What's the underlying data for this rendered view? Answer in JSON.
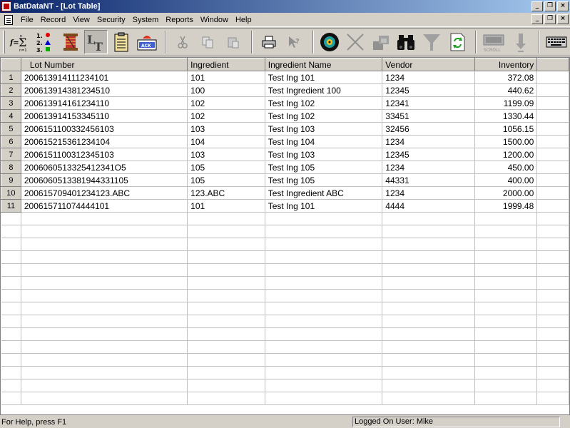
{
  "window": {
    "title": "BatDataNT - [Lot Table]",
    "min_glyph": "_",
    "restore_glyph": "❐",
    "close_glyph": "×"
  },
  "menu": {
    "items": [
      "File",
      "Record",
      "View",
      "Security",
      "System",
      "Reports",
      "Window",
      "Help"
    ]
  },
  "toolbar": {
    "buttons": [
      {
        "icon": "formula-sigma-icon"
      },
      {
        "icon": "numbered-shapes-icon"
      },
      {
        "icon": "thread-spool-icon"
      },
      {
        "icon": "lot-table-icon",
        "active": true
      },
      {
        "icon": "clipboard-icon"
      },
      {
        "icon": "ack-alarm-icon",
        "label": "ACK"
      },
      {
        "icon": "cut-icon"
      },
      {
        "icon": "copy-icon"
      },
      {
        "icon": "paste-icon"
      },
      {
        "icon": "print-icon"
      },
      {
        "icon": "context-help-icon"
      },
      {
        "icon": "disc-icon"
      },
      {
        "icon": "delete-x-icon"
      },
      {
        "icon": "stamp-icon"
      },
      {
        "icon": "binoculars-find-icon"
      },
      {
        "icon": "filter-funnel-icon"
      },
      {
        "icon": "refresh-doc-icon"
      },
      {
        "icon": "scroll-icon",
        "label": "SCROLL"
      },
      {
        "icon": "down-arrow-icon"
      },
      {
        "icon": "keyboard-icon"
      }
    ]
  },
  "table": {
    "columns": [
      "Lot Number",
      "Ingredient",
      "Ingredient Name",
      "Vendor",
      "Inventory"
    ],
    "rows": [
      {
        "n": "1",
        "lot": "200613914111234101",
        "ing": "101",
        "name": "Test Ing 101",
        "vendor": "1234",
        "inv": "372.08"
      },
      {
        "n": "2",
        "lot": "200613914381234510",
        "ing": "100",
        "name": "Test Ingredient 100",
        "vendor": "12345",
        "inv": "440.62"
      },
      {
        "n": "3",
        "lot": "200613914161234110",
        "ing": "102",
        "name": "Test Ing 102",
        "vendor": "12341",
        "inv": "1199.09"
      },
      {
        "n": "4",
        "lot": "200613914153345110",
        "ing": "102",
        "name": "Test Ing 102",
        "vendor": "33451",
        "inv": "1330.44"
      },
      {
        "n": "5",
        "lot": "2006151100332456103",
        "ing": "103",
        "name": "Test Ing 103",
        "vendor": "32456",
        "inv": "1056.15"
      },
      {
        "n": "6",
        "lot": "200615215361234104",
        "ing": "104",
        "name": "Test Ing 104",
        "vendor": "1234",
        "inv": "1500.00"
      },
      {
        "n": "7",
        "lot": "2006151100312345103",
        "ing": "103",
        "name": "Test Ing 103",
        "vendor": "12345",
        "inv": "1200.00"
      },
      {
        "n": "8",
        "lot": "2006060513325412341O5",
        "ing": "105",
        "name": "Test Ing 105",
        "vendor": "1234",
        "inv": "450.00"
      },
      {
        "n": "9",
        "lot": "2006060513381944331105",
        "ing": "105",
        "name": "Test Ing 105",
        "vendor": "44331",
        "inv": "400.00"
      },
      {
        "n": "10",
        "lot": "200615709401234123.ABC",
        "ing": "123.ABC",
        "name": "Test Ingredient ABC",
        "vendor": "1234",
        "inv": "2000.00"
      },
      {
        "n": "11",
        "lot": "200615711074444101",
        "ing": "101",
        "name": "Test Ing 101",
        "vendor": "4444",
        "inv": "1999.48"
      }
    ],
    "empty_rows": 15
  },
  "status": {
    "help_text": "For Help, press F1",
    "user_text": "Logged On User: Mike"
  }
}
